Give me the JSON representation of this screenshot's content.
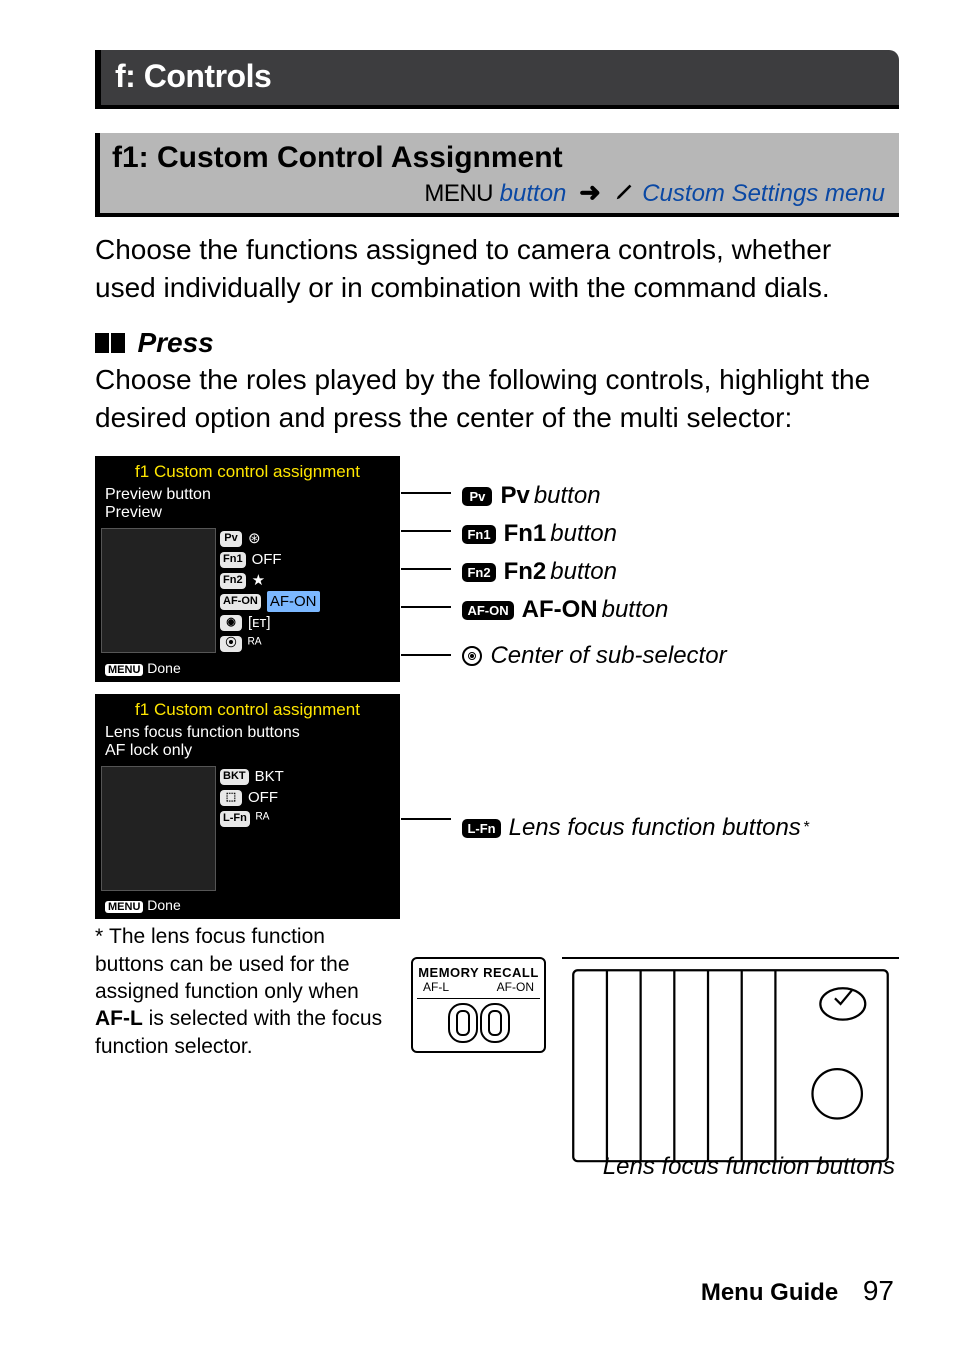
{
  "section_header": "f: Controls",
  "sub_header": {
    "title": "f1: Custom Control Assignment",
    "menu_word": "MENU",
    "button_word": "button",
    "arrow": "➜",
    "breadcrumb": "Custom Settings menu"
  },
  "intro": "Choose the functions assigned to camera controls, whether used individually or in combination with the command dials.",
  "press_heading": "Press",
  "press_body": "Choose the roles played by the following controls, highlight the desired option and press the center of the multi selector:",
  "screenshot1": {
    "title": "Custom control assignment",
    "prefix": "f1",
    "line1": "Preview button",
    "line2": "Preview",
    "rows": [
      {
        "badge": "Pv",
        "val": "⊛"
      },
      {
        "badge": "Fn1",
        "val": "OFF"
      },
      {
        "badge": "Fn2",
        "val": "★"
      },
      {
        "badge": "AF-ON",
        "val": "AF-ON"
      },
      {
        "badge": "◉",
        "val": "[ᴇᴛ]"
      },
      {
        "badge": "⦿",
        "val": "ᴿᴬ"
      }
    ],
    "done_pill": "MENU",
    "done_text": "Done"
  },
  "screenshot2": {
    "title": "Custom control assignment",
    "prefix": "f1",
    "line1": "Lens focus function buttons",
    "line2": "AF lock only",
    "rows": [
      {
        "badge": "BKT",
        "val": "BKT"
      },
      {
        "badge": "⬚",
        "val": "OFF"
      },
      {
        "badge": "L-Fn",
        "val": "ᴿᴬ"
      }
    ],
    "done_pill": "MENU",
    "done_text": "Done"
  },
  "callouts": {
    "pv": {
      "badge": "Pv",
      "bold": "Pv",
      "ital": "button"
    },
    "fn1": {
      "badge": "Fn1",
      "bold": "Fn1",
      "ital": "button"
    },
    "fn2": {
      "badge": "Fn2",
      "bold": "Fn2",
      "ital": "button"
    },
    "afon": {
      "badge": "AF-ON",
      "bold": "AF-ON",
      "ital": "button"
    },
    "center": {
      "ital": "Center of sub-selector"
    },
    "lensfn": {
      "badge": "L-Fn",
      "ital": "Lens focus function buttons",
      "sup": "*"
    }
  },
  "footnote": "The lens focus function buttons can be used for the assigned function only when AF-L is selected with the focus function selector.",
  "footnote_bold": "AF-L",
  "switch": {
    "top": "MEMORY RECALL",
    "left": "AF-L",
    "right": "AF-ON"
  },
  "lens_caption": "Lens focus function buttons",
  "footer": {
    "label": "Menu Guide",
    "page": "97"
  }
}
